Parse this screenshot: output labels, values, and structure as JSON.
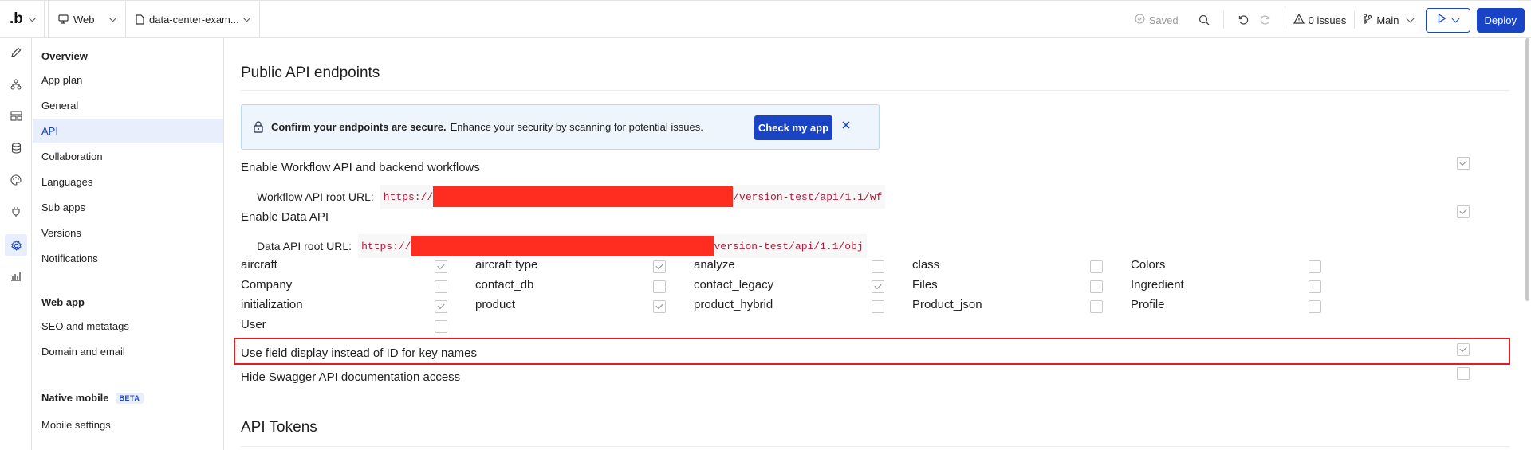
{
  "topbar": {
    "logo": ".b",
    "platform": "Web",
    "app_name": "data-center-exam...",
    "saved": "Saved",
    "issues": "0 issues",
    "branch": "Main",
    "deploy": "Deploy"
  },
  "rail": {
    "icons": [
      "pencil-icon",
      "workflow-icon",
      "layout-icon",
      "database-icon",
      "palette-icon",
      "plug-icon",
      "settings-icon",
      "chart-icon"
    ]
  },
  "sidebar": {
    "section1": "Overview",
    "items1": [
      "App plan",
      "General",
      "API",
      "Collaboration",
      "Languages",
      "Sub apps",
      "Versions",
      "Notifications"
    ],
    "section2": "Web app",
    "items2": [
      "SEO and metatags",
      "Domain and email"
    ],
    "section3": "Native mobile",
    "beta": "BETA",
    "items3": [
      "Mobile settings"
    ]
  },
  "main": {
    "title": "Public API endpoints",
    "banner": {
      "bold": "Confirm your endpoints are secure.",
      "text": "Enhance your security by scanning for potential issues.",
      "button": "Check my app"
    },
    "workflow_api": {
      "label": "Enable Workflow API and backend workflows",
      "checked": true,
      "url_label": "Workflow API root URL:",
      "url_prefix": "https://",
      "url_suffix": "/version-test/api/1.1/wf"
    },
    "data_api": {
      "label": "Enable Data API",
      "checked": true,
      "url_label": "Data API root URL:",
      "url_prefix": "https://",
      "url_suffix": "version-test/api/1.1/obj"
    },
    "data_types": [
      {
        "name": "aircraft",
        "checked": true
      },
      {
        "name": "aircraft type",
        "checked": true
      },
      {
        "name": "analyze",
        "checked": false
      },
      {
        "name": "class",
        "checked": false
      },
      {
        "name": "Colors",
        "checked": false
      },
      {
        "name": "Company",
        "checked": false
      },
      {
        "name": "contact_db",
        "checked": false
      },
      {
        "name": "contact_legacy",
        "checked": true
      },
      {
        "name": "Files",
        "checked": false
      },
      {
        "name": "Ingredient",
        "checked": false
      },
      {
        "name": "initialization",
        "checked": true
      },
      {
        "name": "product",
        "checked": true
      },
      {
        "name": "product_hybrid",
        "checked": false
      },
      {
        "name": "Product_json",
        "checked": false
      },
      {
        "name": "Profile",
        "checked": false
      },
      {
        "name": "User",
        "checked": false
      }
    ],
    "field_display": {
      "label": "Use field display instead of ID for key names",
      "checked": true
    },
    "hide_swagger": {
      "label": "Hide Swagger API documentation access",
      "checked": false
    },
    "tokens_title": "API Tokens"
  },
  "colors": {
    "accent": "#1a44c6",
    "highlight": "#e02020",
    "redaction": "#ff2d1f",
    "banner_bg": "#eef5fd"
  }
}
